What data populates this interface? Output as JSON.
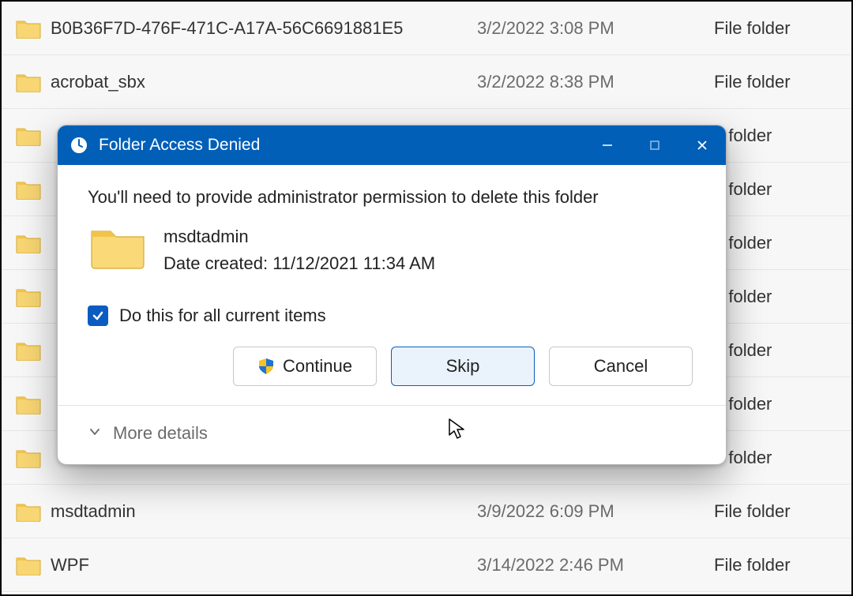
{
  "file_list": {
    "type_label": "File folder",
    "rows": [
      {
        "name": "B0B36F7D-476F-471C-A17A-56C6691881E5",
        "date": "3/2/2022 3:08 PM"
      },
      {
        "name": "acrobat_sbx",
        "date": "3/2/2022 8:38 PM"
      },
      {
        "name": "",
        "date": ""
      },
      {
        "name": "",
        "date": ""
      },
      {
        "name": "",
        "date": ""
      },
      {
        "name": "",
        "date": ""
      },
      {
        "name": "",
        "date": ""
      },
      {
        "name": "",
        "date": ""
      },
      {
        "name": "",
        "date": ""
      },
      {
        "name": "msdtadmin",
        "date": "3/9/2022 6:09 PM"
      },
      {
        "name": "WPF",
        "date": "3/14/2022 2:46 PM"
      }
    ]
  },
  "dialog": {
    "title": "Folder Access Denied",
    "message": "You'll need to provide administrator permission to delete this folder",
    "folder_name": "msdtadmin",
    "date_created_label": "Date created: 11/12/2021 11:34 AM",
    "checkbox_label": "Do this for all current items",
    "checkbox_checked": true,
    "buttons": {
      "continue": "Continue",
      "skip": "Skip",
      "cancel": "Cancel"
    },
    "more_details": "More details"
  }
}
